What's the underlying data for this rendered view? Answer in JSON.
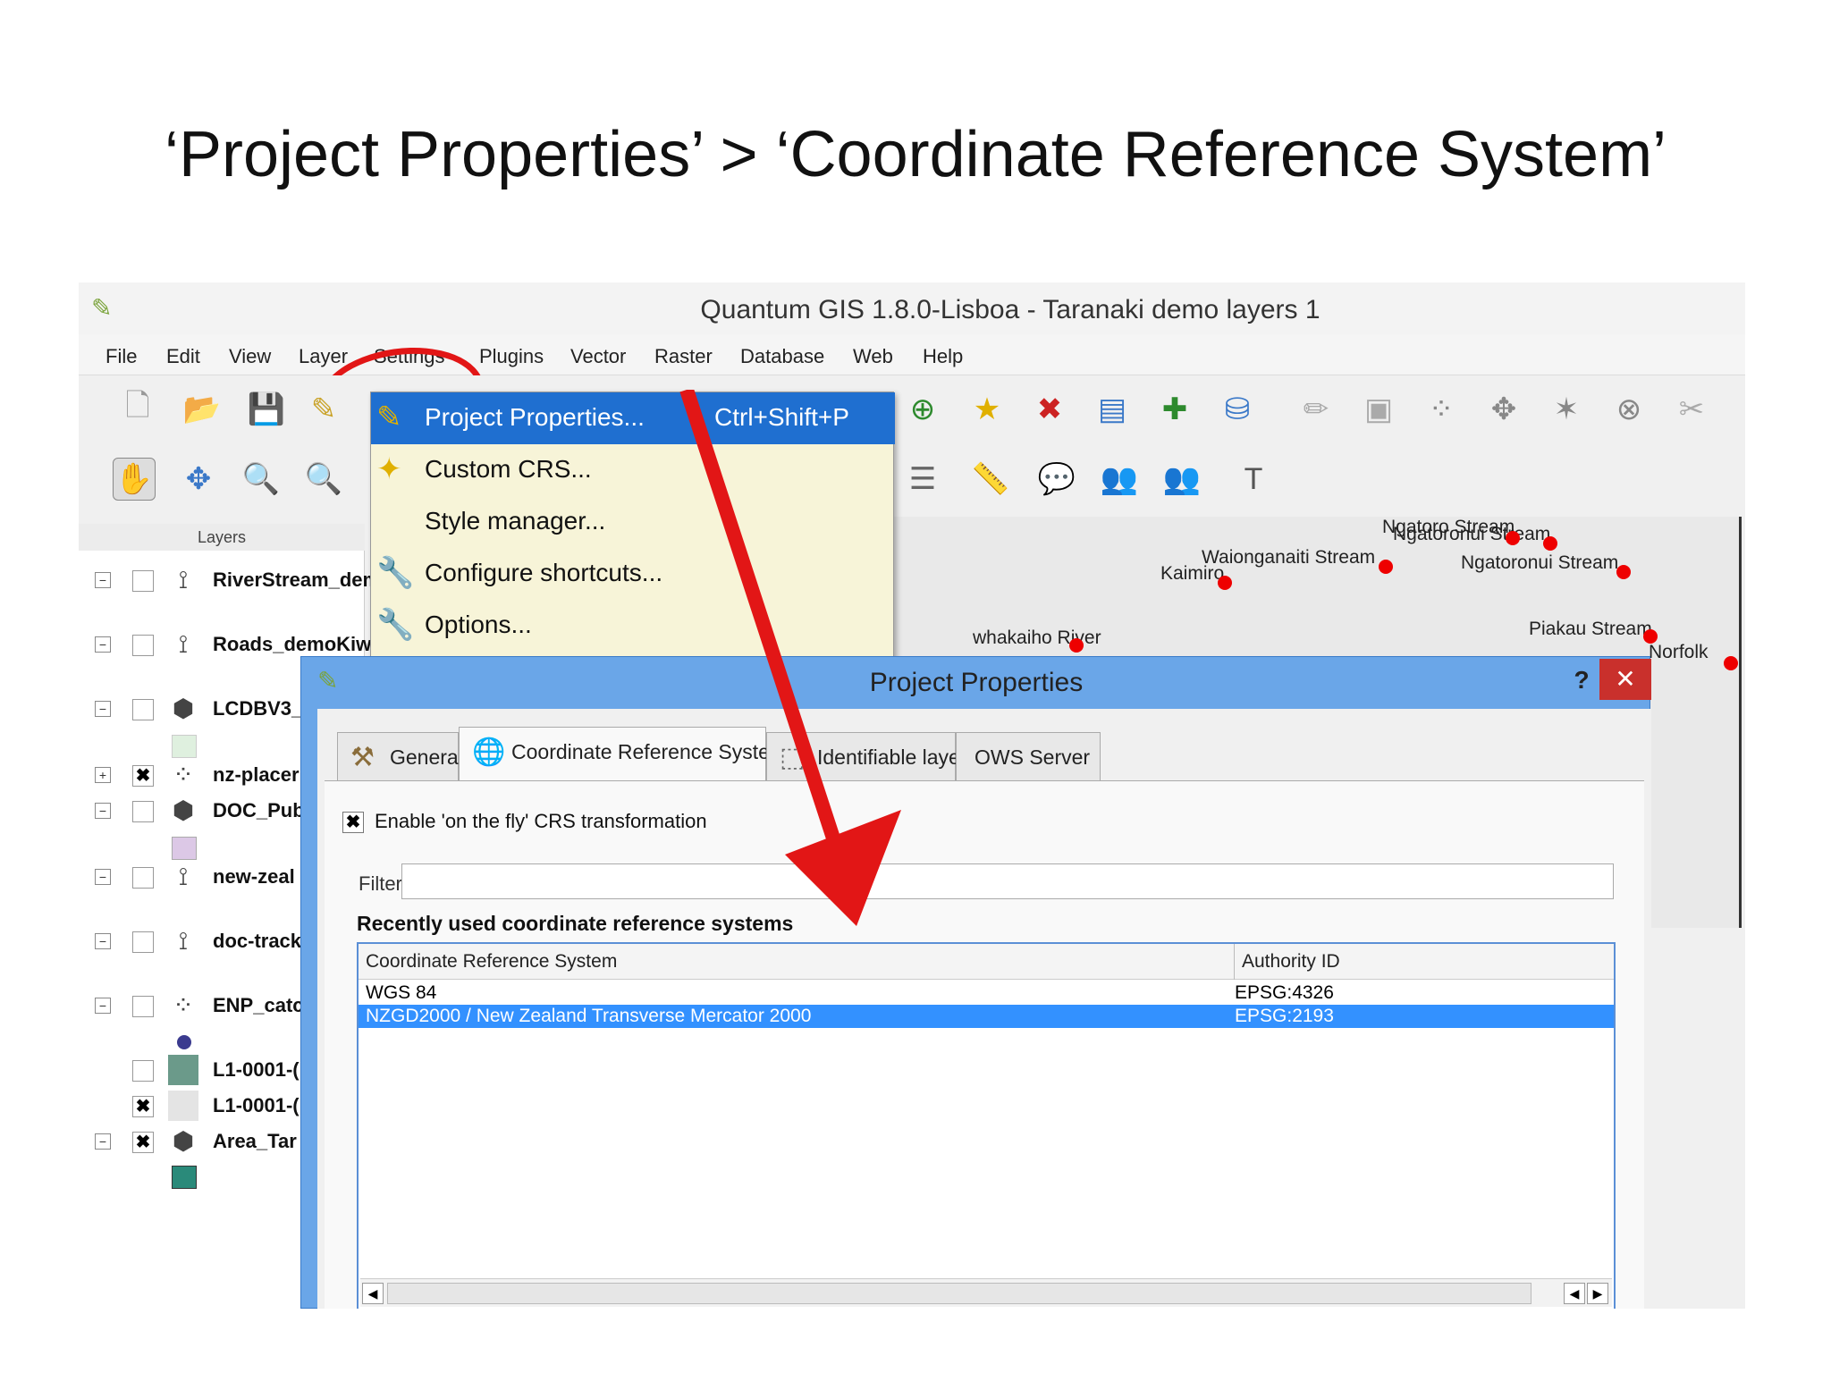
{
  "slide": {
    "title": "‘Project Properties’ > ‘Coordinate Reference System’"
  },
  "window": {
    "title": "Quantum GIS 1.8.0-Lisboa - Taranaki demo layers 1"
  },
  "menubar": {
    "items": [
      "File",
      "Edit",
      "View",
      "Layer",
      "Settings",
      "Plugins",
      "Vector",
      "Raster",
      "Database",
      "Web",
      "Help"
    ]
  },
  "settings_menu": {
    "items": [
      {
        "label": "Project Properties...",
        "shortcut": "Ctrl+Shift+P"
      },
      {
        "label": "Custom CRS..."
      },
      {
        "label": "Style manager..."
      },
      {
        "label": "Configure shortcuts..."
      },
      {
        "label": "Options..."
      }
    ]
  },
  "layers_panel": {
    "header": "Layers",
    "layers": [
      {
        "name": "RiverStream_dem",
        "checked": false
      },
      {
        "name": "Roads_demoKiw",
        "checked": false
      },
      {
        "name": "LCDBV3_",
        "checked": false
      },
      {
        "name": "nz-placer",
        "checked": true
      },
      {
        "name": "DOC_Pub",
        "checked": false
      },
      {
        "name": "new-zeal",
        "checked": false
      },
      {
        "name": "doc-track",
        "checked": false
      },
      {
        "name": "ENP_catc",
        "checked": false
      },
      {
        "name": "L1-0001-(",
        "checked": false
      },
      {
        "name": "L1-0001-(",
        "checked": true
      },
      {
        "name": "Area_Tar",
        "checked": true
      }
    ]
  },
  "map": {
    "labels": [
      "Ngatoro Stream",
      "Ngatoronui Stream",
      "Waionganaiti Stream",
      "Kaimiro",
      "Ngatoronui Stream",
      "whakaiho River",
      "Piakau Stream",
      "Norfolk"
    ]
  },
  "dialog": {
    "title": "Project Properties",
    "help": "?",
    "close": "✕",
    "tabs": [
      "General",
      "Coordinate Reference System (CRS)",
      "Identifiable layers",
      "OWS Server"
    ],
    "otf_label": "Enable 'on the fly' CRS transformation",
    "otf_checked": true,
    "filter_label": "Filter",
    "filter_value": "",
    "recent_heading": "Recently used coordinate reference systems",
    "table": {
      "columns": [
        "Coordinate Reference System",
        "Authority ID"
      ],
      "rows": [
        {
          "crs": "WGS 84",
          "id": "EPSG:4326",
          "selected": false
        },
        {
          "crs": "NZGD2000 / New Zealand Transverse Mercator 2000",
          "id": "EPSG:2193",
          "selected": true
        }
      ]
    }
  },
  "colors": {
    "highlight": "#3391ff",
    "menu_active": "#1f6fd0",
    "annotation_red": "#e21616",
    "dialog_frame": "#6aa6e8"
  }
}
